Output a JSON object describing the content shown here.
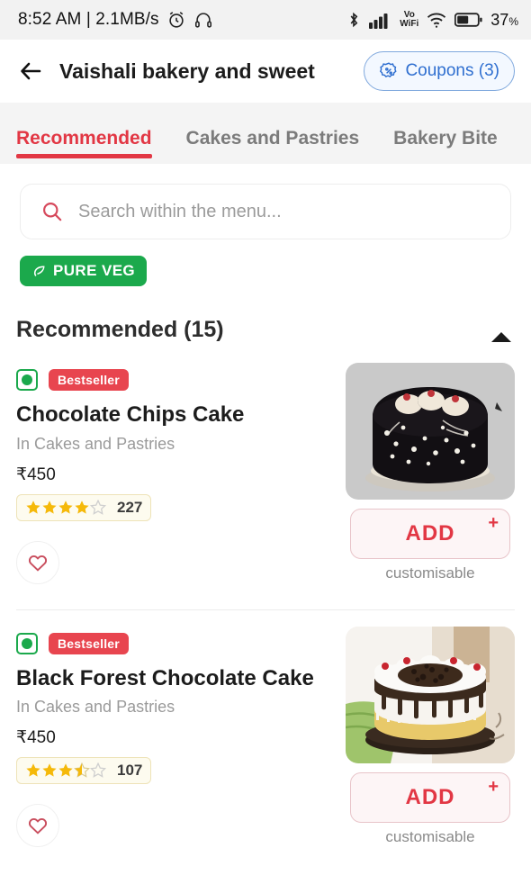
{
  "status_bar": {
    "time": "8:52 AM",
    "separator": "|",
    "network_speed": "2.1MB/s",
    "alarm_icon": "alarm-icon",
    "headphone_icon": "headphone-icon",
    "bluetooth_icon": "bluetooth-icon",
    "signal_icon": "cellular-signal-icon",
    "volte_label": "Vo",
    "volte_sub": "WiFi",
    "wifi_icon": "wifi-icon",
    "battery_percent": "37",
    "battery_percent_symbol": "%"
  },
  "header": {
    "back_icon": "back-arrow-icon",
    "title": "Vaishali bakery and sweet",
    "coupons_label": "Coupons (3)",
    "coupons_icon": "discount-badge-icon"
  },
  "tabs": [
    {
      "label": "Recommended",
      "active": true
    },
    {
      "label": "Cakes and Pastries",
      "active": false
    },
    {
      "label": "Bakery Bite",
      "active": false
    }
  ],
  "search": {
    "placeholder": "Search within the menu...",
    "value": "",
    "icon": "search-icon"
  },
  "filters": [
    {
      "label": "PURE VEG",
      "icon": "leaf-icon",
      "color": "#1ba94c"
    }
  ],
  "section": {
    "title": "Recommended (15)",
    "collapse_icon": "caret-up-icon"
  },
  "colors": {
    "accent_red": "#e23744",
    "bestseller_red": "#e8454f",
    "veg_green": "#1ba94c",
    "coupon_blue": "#2f6fd0",
    "star_gold": "#f5b90a"
  },
  "items": [
    {
      "veg": true,
      "badge": "Bestseller",
      "name": "Chocolate Chips Cake",
      "category": "In Cakes and Pastries",
      "price": "₹450",
      "rating_stars": 4,
      "rating_count": "227",
      "add_label": "ADD",
      "add_plus": "+",
      "customisable": "customisable",
      "favourite_icon": "heart-icon",
      "image_alt": "chocolate-chips-cake-photo"
    },
    {
      "veg": true,
      "badge": "Bestseller",
      "name": "Black Forest Chocolate Cake",
      "category": "In Cakes and Pastries",
      "price": "₹450",
      "rating_stars": 3.5,
      "rating_count": "107",
      "add_label": "ADD",
      "add_plus": "+",
      "customisable": "customisable",
      "favourite_icon": "heart-icon",
      "image_alt": "black-forest-chocolate-cake-photo"
    }
  ]
}
